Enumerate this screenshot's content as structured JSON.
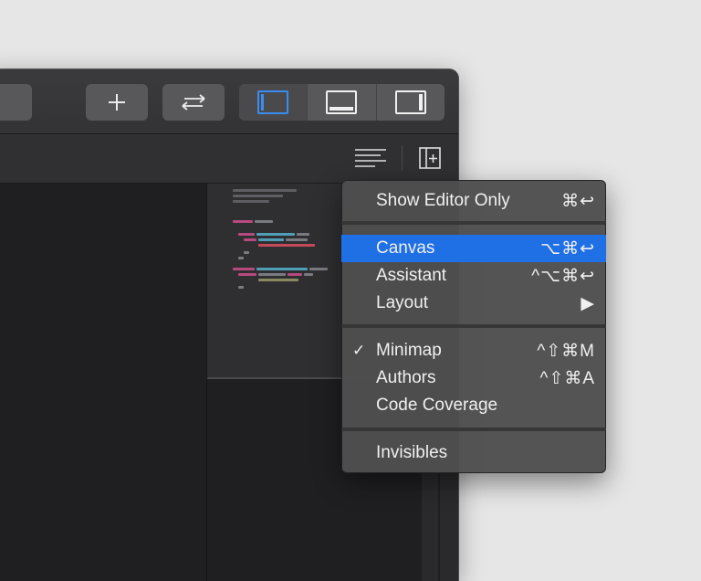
{
  "menu": {
    "items": [
      {
        "label": "Show Editor Only",
        "shortcut": "⌘↩",
        "checked": false,
        "highlighted": false
      },
      {
        "label": "Canvas",
        "shortcut": "⌥⌘↩",
        "checked": false,
        "highlighted": true
      },
      {
        "label": "Assistant",
        "shortcut": "^⌥⌘↩",
        "checked": false,
        "highlighted": false
      },
      {
        "label": "Layout",
        "shortcut": "▶",
        "checked": false,
        "highlighted": false
      },
      {
        "label": "Minimap",
        "shortcut": "^⇧⌘M",
        "checked": true,
        "highlighted": false
      },
      {
        "label": "Authors",
        "shortcut": "^⇧⌘A",
        "checked": false,
        "highlighted": false
      },
      {
        "label": "Code Coverage",
        "shortcut": "",
        "checked": false,
        "highlighted": false
      },
      {
        "label": "Invisibles",
        "shortcut": "",
        "checked": false,
        "highlighted": false
      }
    ],
    "check_glyph": "✓",
    "highlight_color": "#1f6fe5"
  },
  "toolbar": {
    "add_icon": "plus-icon",
    "swap_icon": "swap-arrows-icon",
    "layout_icons": [
      "navigator-panel-icon",
      "debug-panel-icon",
      "inspector-panel-icon"
    ],
    "accent_color": "#3a8cf0"
  },
  "jumpbar": {
    "icons": [
      "editor-options-icon",
      "add-editor-icon"
    ]
  }
}
